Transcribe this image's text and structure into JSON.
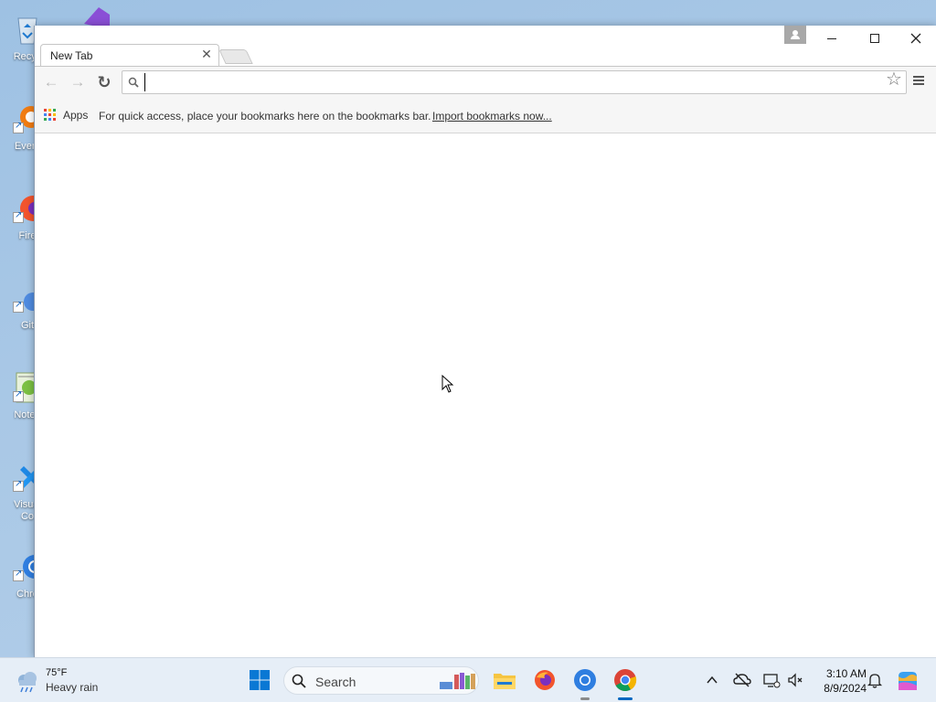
{
  "desktop": {
    "icons": [
      {
        "label": "Recyc",
        "name": "recycle-bin"
      },
      {
        "label": "Every",
        "name": "everything"
      },
      {
        "label": "Fire",
        "name": "firefox"
      },
      {
        "label": "Git",
        "name": "git"
      },
      {
        "label": "Notep",
        "name": "notepad"
      },
      {
        "label": "Visual\nCo",
        "name": "visual-studio-code"
      },
      {
        "label": "Chro",
        "name": "chromium"
      }
    ]
  },
  "browser": {
    "tab": {
      "title": "New Tab",
      "close": "✕"
    },
    "toolbar": {
      "back": "←",
      "forward": "→",
      "reload": "↻",
      "omnibox_value": "",
      "star": "☆"
    },
    "bookmarks_bar": {
      "apps_label": "Apps",
      "hint": "For quick access, place your bookmarks here on the bookmarks bar.",
      "import_link": "Import bookmarks now..."
    }
  },
  "taskbar": {
    "weather": {
      "temp": "75°F",
      "desc": "Heavy rain"
    },
    "search_label": "Search",
    "clock": {
      "time": "3:10 AM",
      "date": "8/9/2024"
    }
  },
  "colors": {
    "accent": "#0067c0",
    "desktop_bg": "#a9c8e6",
    "toolbar_bg": "#f6f6f6",
    "taskbar_bg": "#e6eef7"
  }
}
